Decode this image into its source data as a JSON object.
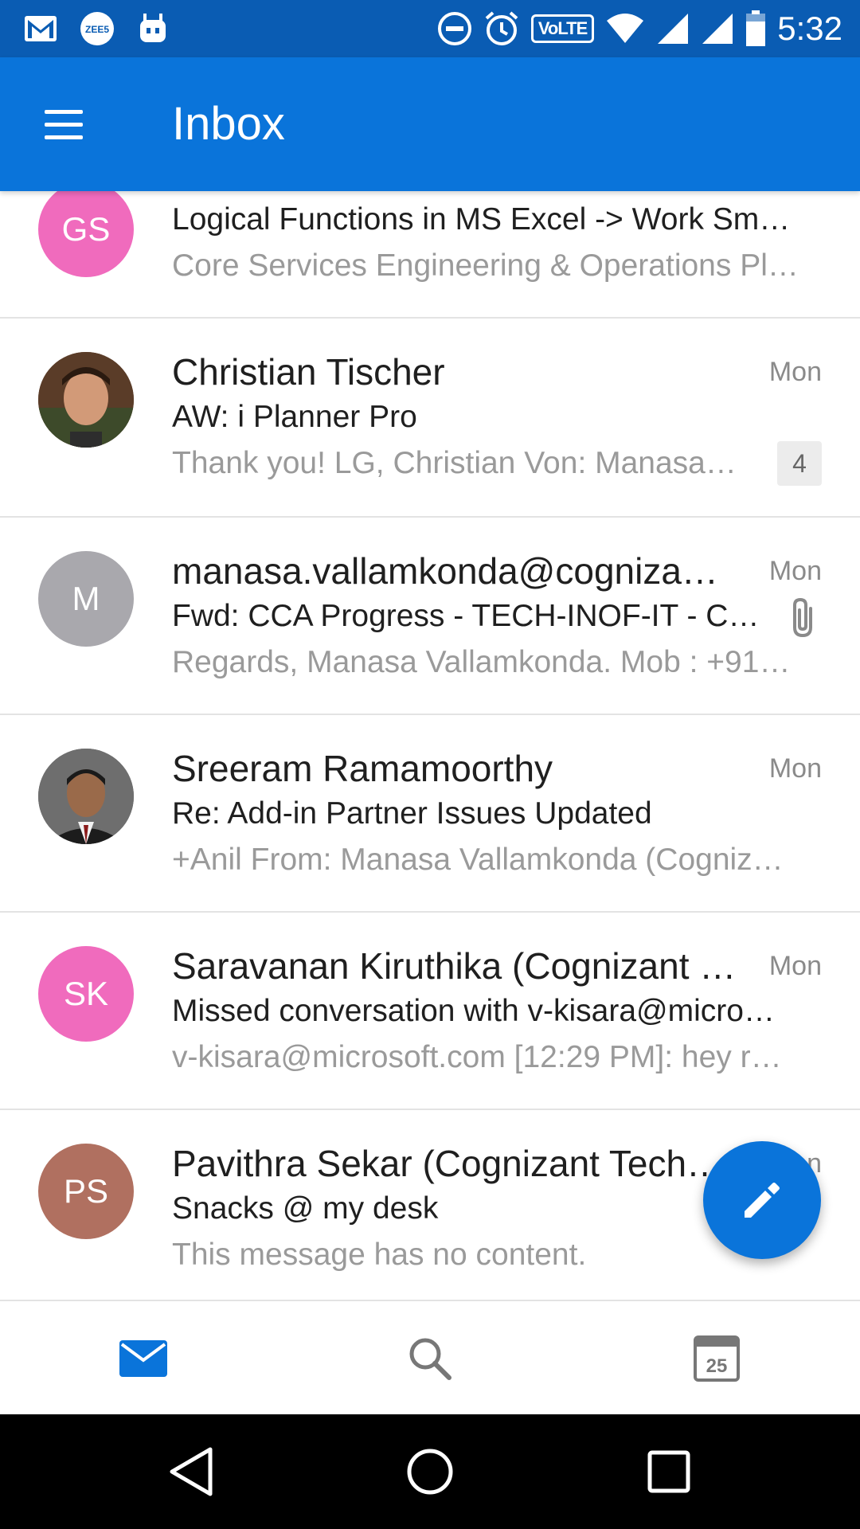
{
  "status_bar": {
    "time": "5:32",
    "volte": "VoLTE",
    "left_icons": [
      "gmail-icon",
      "zee5-icon",
      "bot-icon"
    ],
    "right_icons": [
      "do-not-disturb-icon",
      "alarm-icon",
      "volte-icon",
      "wifi-icon",
      "signal-icon",
      "signal-icon",
      "battery-icon"
    ]
  },
  "app_bar": {
    "title": "Inbox",
    "menu_icon": "hamburger-menu-icon"
  },
  "colors": {
    "primary": "#0a74da",
    "status_bar": "#0a5cb3",
    "avatar_pink": "#f06bbd",
    "avatar_gray": "#a9a8ad",
    "avatar_brown": "#b07060"
  },
  "messages": [
    {
      "initials": "GS",
      "sender": "",
      "subject": "Logical Functions in MS Excel -> Work Sm…",
      "preview": "Core Services Engineering & Operations Pl…",
      "date": "",
      "avatar_color": "#f06bbd"
    },
    {
      "initials": "",
      "sender": "Christian Tischer",
      "subject": "AW: i Planner Pro",
      "preview": "Thank you! LG, Christian Von: Manasa…",
      "date": "Mon",
      "count": "4",
      "avatar_type": "photo"
    },
    {
      "initials": "M",
      "sender": "manasa.vallamkonda@cogniza…",
      "subject": "Fwd: CCA Progress - TECH-INOF-IT - C…",
      "preview": "Regards, Manasa Vallamkonda. Mob : +91…",
      "date": "Mon",
      "attachment_icon": "paperclip-icon",
      "avatar_color": "#a9a8ad"
    },
    {
      "initials": "",
      "sender": "Sreeram Ramamoorthy",
      "subject": "Re: Add-in Partner Issues Updated",
      "preview": "+Anil From: Manasa Vallamkonda (Cogniz…",
      "date": "Mon",
      "avatar_type": "photo"
    },
    {
      "initials": "SK",
      "sender": "Saravanan Kiruthika (Cognizant …",
      "subject": "Missed conversation with v-kisara@micro…",
      "preview": "v-kisara@microsoft.com [12:29 PM]: hey r…",
      "date": "Mon",
      "avatar_color": "#f06bbd"
    },
    {
      "initials": "PS",
      "sender": "Pavithra Sekar (Cognizant Tech…",
      "subject": "Snacks @ my desk",
      "preview": "This message has no content.",
      "date": "Mon",
      "avatar_color": "#b07060"
    }
  ],
  "fab": {
    "icon": "compose-pencil-icon"
  },
  "tab_bar": {
    "tabs": [
      {
        "name": "mail",
        "icon": "mail-icon",
        "active": true
      },
      {
        "name": "search",
        "icon": "search-icon",
        "active": false
      },
      {
        "name": "calendar",
        "icon": "calendar-icon",
        "date": "25",
        "active": false
      }
    ]
  },
  "nav_bar": {
    "buttons": [
      "back-icon",
      "home-icon",
      "recents-icon"
    ]
  }
}
